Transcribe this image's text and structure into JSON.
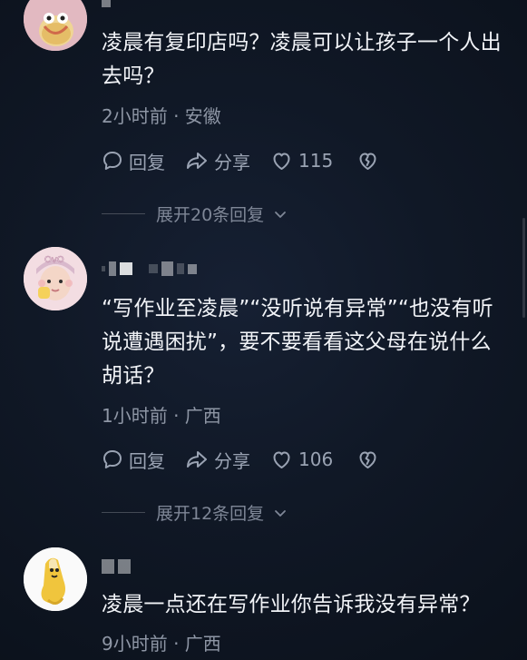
{
  "comments": [
    {
      "text": "凌晨有复印店吗？凌晨可以让孩子一个人出去吗？",
      "meta": "2小时前 · 安徽",
      "actions": {
        "reply_label": "回复",
        "share_label": "分享",
        "like_count": "115"
      },
      "expand_label": "展开20条回复"
    },
    {
      "text": "“写作业至凌晨”“没听说有异常”“也没有听说遭遇困扰”，要不要看看这父母在说什么胡话？",
      "meta": "1小时前 · 广西",
      "actions": {
        "reply_label": "回复",
        "share_label": "分享",
        "like_count": "106"
      },
      "expand_label": "展开12条回复"
    },
    {
      "text": "凌晨一点还在写作业你告诉我没有异常？",
      "meta": "9小时前 · 广西"
    }
  ],
  "icons": {
    "reply": "speech-bubble-icon",
    "share": "share-arrow-icon",
    "like": "heart-outline-icon",
    "dislike": "broken-heart-icon",
    "expand": "chevron-down-icon"
  },
  "colors": {
    "background": "#101826",
    "text": "#f1f3f7",
    "meta": "#8e96a5",
    "icon": "#9aa3b3"
  }
}
